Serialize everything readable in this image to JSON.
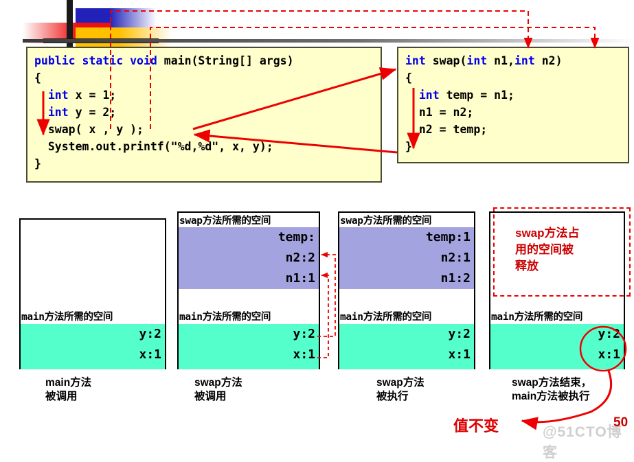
{
  "slide": {
    "page_number": "50",
    "watermark": "@51CTO博客"
  },
  "code_main": {
    "lines": [
      [
        {
          "t": "public ",
          "c": "kw"
        },
        {
          "t": "static ",
          "c": "kw"
        },
        {
          "t": "void ",
          "c": "kw"
        },
        {
          "t": "main(String[] args)",
          "c": ""
        }
      ],
      [
        {
          "t": "{",
          "c": ""
        }
      ],
      [
        {
          "t": "  int ",
          "c": "kw"
        },
        {
          "t": "x = 1;",
          "c": ""
        }
      ],
      [
        {
          "t": "  int ",
          "c": "kw"
        },
        {
          "t": "y = 2;",
          "c": ""
        }
      ],
      [
        {
          "t": "  swap( x , y );",
          "c": ""
        }
      ],
      [
        {
          "t": "  System.out.printf(\"%d,%d\", x, y);",
          "c": ""
        }
      ],
      [
        {
          "t": "}",
          "c": ""
        }
      ]
    ]
  },
  "code_swap": {
    "lines": [
      [
        {
          "t": "int ",
          "c": "kw"
        },
        {
          "t": "swap(",
          "c": ""
        },
        {
          "t": "int ",
          "c": "kw"
        },
        {
          "t": "n1,",
          "c": ""
        },
        {
          "t": "int ",
          "c": "kw"
        },
        {
          "t": "n2)",
          "c": ""
        }
      ],
      [
        {
          "t": "{",
          "c": ""
        }
      ],
      [
        {
          "t": "  int ",
          "c": "kw"
        },
        {
          "t": "temp = n1;",
          "c": ""
        }
      ],
      [
        {
          "t": "  n1 = n2;",
          "c": ""
        }
      ],
      [
        {
          "t": "  n2 = temp;",
          "c": ""
        }
      ],
      [
        {
          "t": "}",
          "c": ""
        }
      ]
    ]
  },
  "columns": [
    {
      "id": "col1",
      "swap_label": "",
      "swap_frame": [],
      "main_label": "main方法所需的空间",
      "main_frame": [
        "y:2",
        "x:1"
      ],
      "caption_line1": "main方法",
      "caption_line2": "被调用",
      "freed_note": ""
    },
    {
      "id": "col2",
      "swap_label": "swap方法所需的空间",
      "swap_frame": [
        "temp:",
        "n2:2",
        "n1:1"
      ],
      "main_label": "main方法所需的空间",
      "main_frame": [
        "y:2",
        "x:1"
      ],
      "caption_line1": "swap方法",
      "caption_line2": "被调用",
      "freed_note": ""
    },
    {
      "id": "col3",
      "swap_label": "swap方法所需的空间",
      "swap_frame": [
        "temp:1",
        "n2:1",
        "n1:2"
      ],
      "main_label": "main方法所需的空间",
      "main_frame": [
        "y:2",
        "x:1"
      ],
      "caption_line1": "swap方法",
      "caption_line2": "被执行",
      "freed_note": ""
    },
    {
      "id": "col4",
      "swap_label": "",
      "swap_frame": [],
      "main_label": "main方法所需的空间",
      "main_frame": [
        "y:2",
        "x:1"
      ],
      "caption_line1": "swap方法结束，",
      "caption_line2": "main方法被执行",
      "freed_note": "swap方法占\n用的空间被\n释放"
    }
  ],
  "annotations": {
    "value_unchanged": "值不变"
  },
  "colors": {
    "code_bg": "#FFFFCC",
    "keyword": "#0000EE",
    "swap_frame_fill": "#A3A3E0",
    "main_frame_fill": "#55FFCC",
    "arrow_red": "#EE0000",
    "freed_text": "#CC0000"
  }
}
